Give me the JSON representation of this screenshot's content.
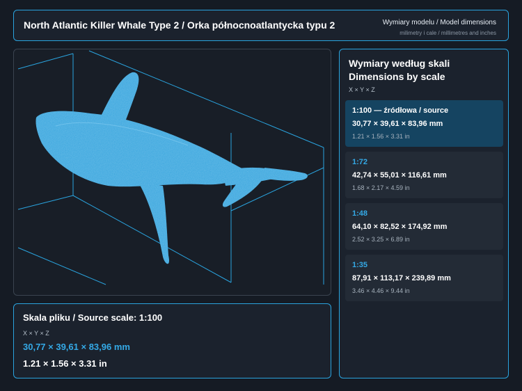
{
  "header": {
    "title": "North Atlantic Killer Whale Type 2 / Orka północnoatlantycka typu 2",
    "subtitle": "Wymiary modelu / Model dimensions",
    "units_note": "milimetry i cale / millimetres and inches"
  },
  "colors": {
    "accent": "#2aa4df",
    "model": "#3aa6de",
    "background": "#151b24",
    "panel": "#1b222d",
    "active_card": "#154461"
  },
  "viewport": {
    "icon": "3d-model-preview"
  },
  "source": {
    "heading": "Skala pliku / Source scale: 1:100",
    "axes": "X × Y × Z",
    "mm": "30,77 × 39,61 × 83,96 mm",
    "inches": "1.21 × 1.56 × 3.31 in"
  },
  "scales": {
    "title_pl": "Wymiary według skali",
    "title_en": "Dimensions by scale",
    "axes": "X × Y × Z",
    "items": [
      {
        "label": "1:100  —  źródłowa / source",
        "mm": "30,77 × 39,61 × 83,96 mm",
        "inches": "1.21 × 1.56 × 3.31 in",
        "active": true
      },
      {
        "label": "1:72",
        "mm": "42,74 × 55,01 × 116,61 mm",
        "inches": "1.68 × 2.17 × 4.59 in",
        "active": false
      },
      {
        "label": "1:48",
        "mm": "64,10 × 82,52 × 174,92 mm",
        "inches": "2.52 × 3.25 × 6.89 in",
        "active": false
      },
      {
        "label": "1:35",
        "mm": "87,91 × 113,17 × 239,89 mm",
        "inches": "3.46 × 4.46 × 9.44 in",
        "active": false
      }
    ]
  }
}
